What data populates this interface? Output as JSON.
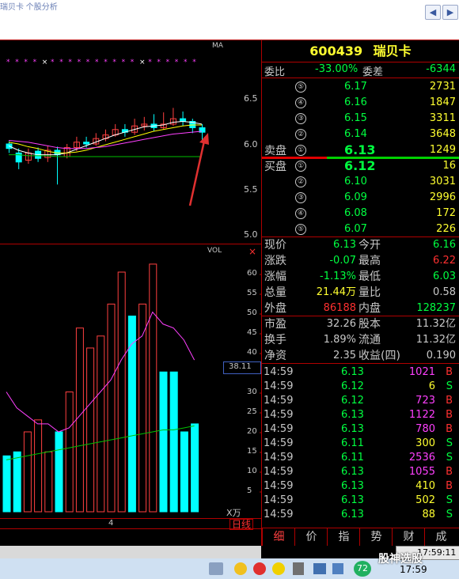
{
  "browser": {
    "crumb": "瑞贝卡 个股分析",
    "back_label": "◀",
    "forward_label": "▶"
  },
  "chart": {
    "ma_label": "MA",
    "vol_label": "VOL",
    "vol_unit": "X万",
    "close_marker": "×",
    "price_ticks": [
      "6.5",
      "6.0",
      "5.5",
      "5.0"
    ],
    "vol_ticks": [
      "60",
      "55",
      "50",
      "45",
      "40",
      "35",
      "30",
      "25",
      "20",
      "15",
      "10",
      "5"
    ],
    "vol_current": "38.11",
    "x_label": "4",
    "day_line_label": "日线",
    "colors": {
      "up": "#ff4040",
      "down": "#00ffff",
      "ma1": "#ffffff",
      "ma2": "#ffff00",
      "ma3": "#ff40ff",
      "ma4": "#00c000"
    }
  },
  "stock": {
    "code": "600439",
    "name": "瑞贝卡",
    "weibi_label": "委比",
    "weibi_value": "-33.00%",
    "weicha_label": "委差",
    "weicha_value": "-6344",
    "sell_label": "卖盘",
    "buy_label": "买盘",
    "asks": [
      {
        "level": "⑤",
        "price": "6.17",
        "vol": "2731"
      },
      {
        "level": "④",
        "price": "6.16",
        "vol": "1847"
      },
      {
        "level": "③",
        "price": "6.15",
        "vol": "3311"
      },
      {
        "level": "②",
        "price": "6.14",
        "vol": "3648"
      },
      {
        "level": "①",
        "price": "6.13",
        "vol": "1249"
      }
    ],
    "bids": [
      {
        "level": "①",
        "price": "6.12",
        "vol": "16"
      },
      {
        "level": "②",
        "price": "6.10",
        "vol": "3031"
      },
      {
        "level": "③",
        "price": "6.09",
        "vol": "2996"
      },
      {
        "level": "④",
        "price": "6.08",
        "vol": "172"
      },
      {
        "level": "⑤",
        "price": "6.07",
        "vol": "226"
      }
    ],
    "quote": [
      {
        "l1": "现价",
        "v1": "6.13",
        "c1": "g",
        "l2": "今开",
        "v2": "6.16",
        "c2": "g"
      },
      {
        "l1": "涨跌",
        "v1": "-0.07",
        "c1": "g",
        "l2": "最高",
        "v2": "6.22",
        "c2": "r"
      },
      {
        "l1": "涨幅",
        "v1": "-1.13%",
        "c1": "g",
        "l2": "最低",
        "v2": "6.03",
        "c2": "g"
      },
      {
        "l1": "总量",
        "v1": "21.44万",
        "c1": "y",
        "l2": "量比",
        "v2": "0.58",
        "c2": "w"
      },
      {
        "l1": "外盘",
        "v1": "86188",
        "c1": "r",
        "l2": "内盘",
        "v2": "128237",
        "c2": "g"
      }
    ],
    "fund": [
      {
        "l1": "市盈",
        "v1": "32.26",
        "l2": "股本",
        "v2": "11.32亿"
      },
      {
        "l1": "换手",
        "v1": "1.89%",
        "l2": "流通",
        "v2": "11.32亿"
      },
      {
        "l1": "净资",
        "v1": "2.35",
        "l2": "收益(四)",
        "v2": "0.190"
      }
    ],
    "ticks": [
      {
        "time": "14:59",
        "price": "6.13",
        "vol": "1021",
        "side": "B",
        "vc": "m"
      },
      {
        "time": "14:59",
        "price": "6.12",
        "vol": "6",
        "side": "S",
        "vc": "y"
      },
      {
        "time": "14:59",
        "price": "6.12",
        "vol": "723",
        "side": "B",
        "vc": "m"
      },
      {
        "time": "14:59",
        "price": "6.13",
        "vol": "1122",
        "side": "B",
        "vc": "m"
      },
      {
        "time": "14:59",
        "price": "6.13",
        "vol": "780",
        "side": "B",
        "vc": "m"
      },
      {
        "time": "14:59",
        "price": "6.11",
        "vol": "300",
        "side": "S",
        "vc": "y"
      },
      {
        "time": "14:59",
        "price": "6.11",
        "vol": "2536",
        "side": "S",
        "vc": "m"
      },
      {
        "time": "14:59",
        "price": "6.13",
        "vol": "1055",
        "side": "B",
        "vc": "m"
      },
      {
        "time": "14:59",
        "price": "6.13",
        "vol": "410",
        "side": "B",
        "vc": "y"
      },
      {
        "time": "14:59",
        "price": "6.13",
        "vol": "502",
        "side": "S",
        "vc": "y"
      },
      {
        "time": "14:59",
        "price": "6.13",
        "vol": "88",
        "side": "S",
        "vc": "y"
      }
    ],
    "tabs": [
      "细",
      "价",
      "指",
      "势",
      "财",
      "成"
    ]
  },
  "taskbar": {
    "clock": "17:59",
    "clock2": "17:59:11",
    "watermark": "股神选股",
    "badge": "72"
  }
}
